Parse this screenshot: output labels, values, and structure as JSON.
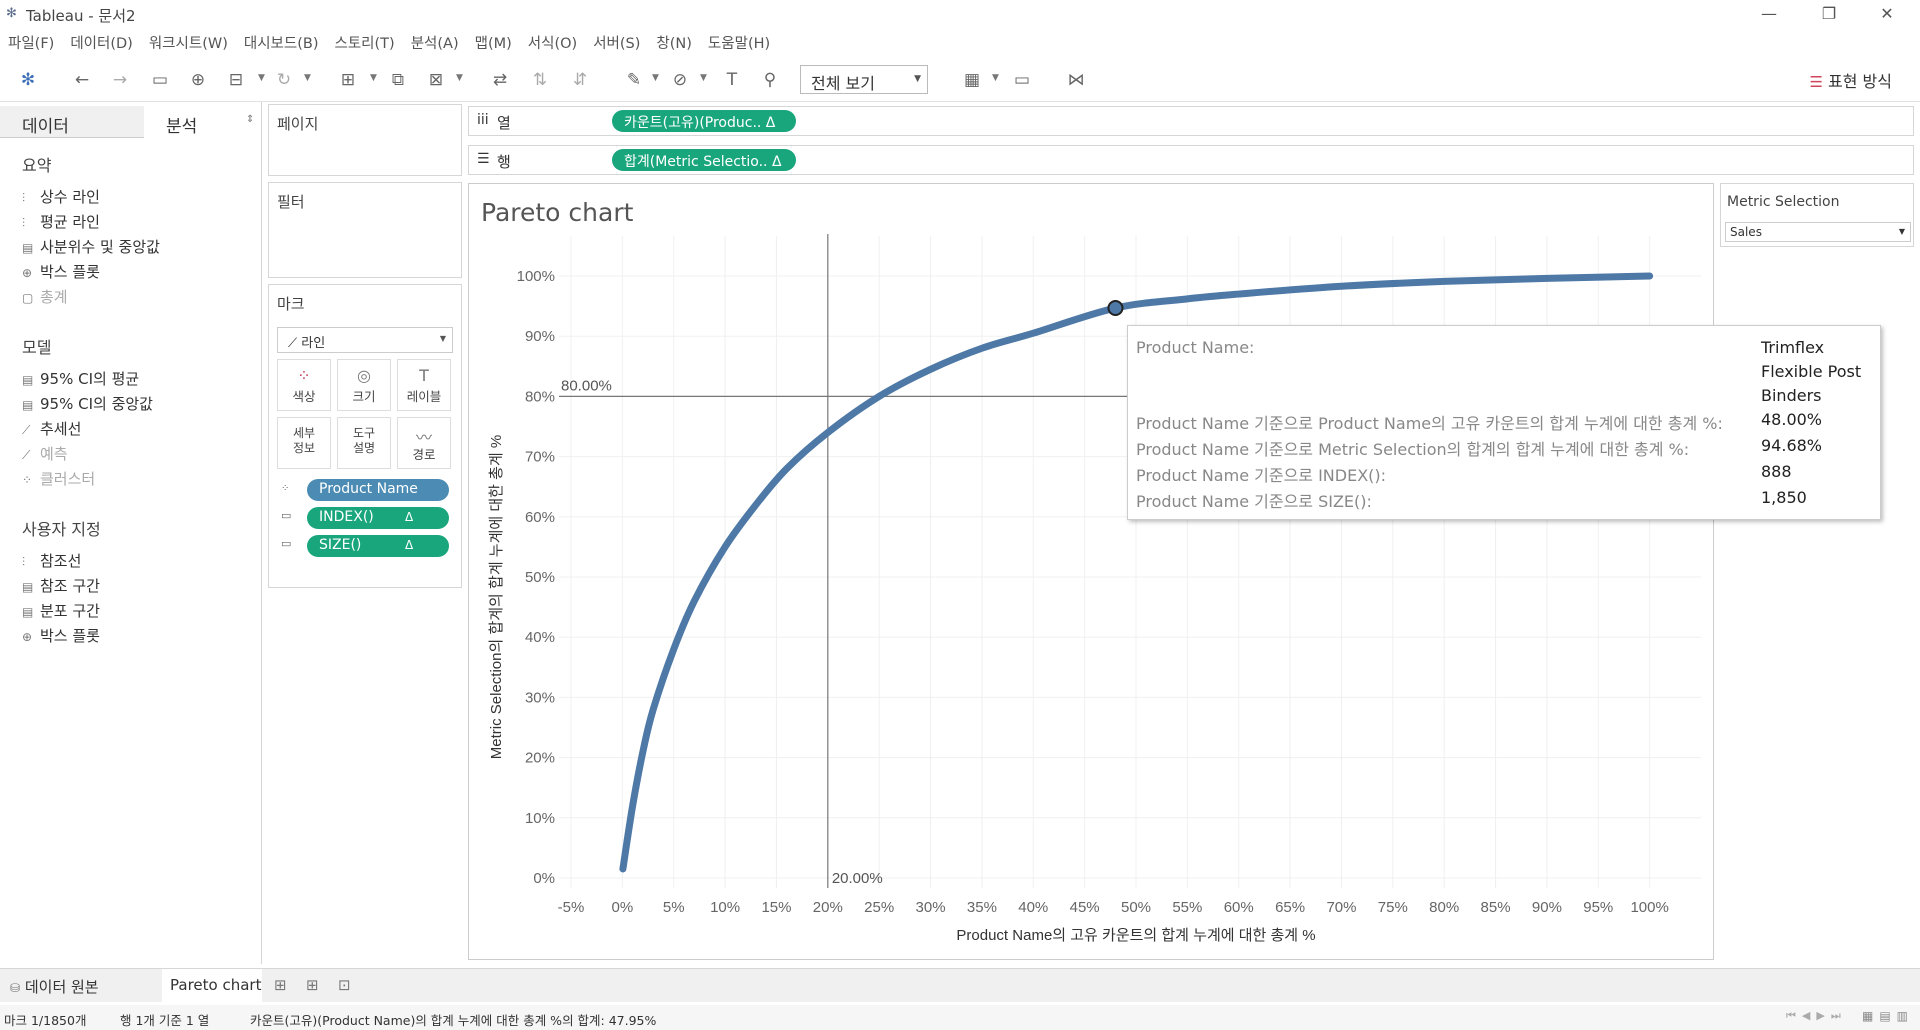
{
  "window": {
    "title": "Tableau - 문서2",
    "minimize": "—",
    "restore": "❐",
    "close": "✕"
  },
  "menu": [
    "파일(F)",
    "데이터(D)",
    "워크시트(W)",
    "대시보드(B)",
    "스토리(T)",
    "분석(A)",
    "맵(M)",
    "서식(O)",
    "서버(S)",
    "창(N)",
    "도움말(H)"
  ],
  "toolbar": {
    "view_mode": "전체 보기",
    "show_me": "표현 방식"
  },
  "left_panel": {
    "tab_data": "데이터",
    "tab_analysis": "분석",
    "summary_title": "요약",
    "summary_items": [
      "상수 라인",
      "평균 라인",
      "사분위수 및 중앙값",
      "박스 플롯",
      "총계"
    ],
    "model_title": "모델",
    "model_items": [
      "95% CI의 평균",
      "95% CI의 중앙값",
      "추세선",
      "예측",
      "클러스터"
    ],
    "custom_title": "사용자 지정",
    "custom_items": [
      "참조선",
      "참조 구간",
      "분포 구간",
      "박스 플롯"
    ]
  },
  "shelves": {
    "pages": "페이지",
    "filters": "필터",
    "marks": "마크",
    "mark_type": "라인",
    "mark_buttons": [
      "색상",
      "크기",
      "레이블",
      "세부\n정보",
      "도구\n설명",
      "경로"
    ],
    "mark_pills": [
      "Product Name",
      "INDEX()",
      "SIZE()"
    ],
    "columns_label": "열",
    "rows_label": "행",
    "columns_pill": "카운트(고유)(Produc.. Δ",
    "rows_pill": "합계(Metric Selectio.. Δ"
  },
  "parameter": {
    "title": "Metric Selection",
    "value": "Sales"
  },
  "chart_data": {
    "type": "line",
    "title": "Pareto chart",
    "xlabel": "Product Name의 고유 카운트의 합계 누계에 대한 총계 %",
    "ylabel": "Metric Selection의 합계의 합계 누계에 대한 총계 %",
    "x_ticks": [
      "-5%",
      "0%",
      "5%",
      "10%",
      "15%",
      "20%",
      "25%",
      "30%",
      "35%",
      "40%",
      "45%",
      "50%",
      "55%",
      "60%",
      "65%",
      "70%",
      "75%",
      "80%",
      "85%",
      "90%",
      "95%",
      "100%"
    ],
    "y_ticks": [
      "0%",
      "10%",
      "20%",
      "30%",
      "40%",
      "50%",
      "60%",
      "70%",
      "80%",
      "90%",
      "100%"
    ],
    "xlim": [
      -5,
      105
    ],
    "ylim": [
      0,
      100
    ],
    "series": [
      {
        "x": [
          0.05,
          1,
          2,
          3,
          5,
          7,
          10,
          13,
          16,
          20,
          25,
          30,
          35,
          40,
          48,
          55,
          60,
          70,
          80,
          90,
          100
        ],
        "y": [
          1.5,
          12,
          21,
          28,
          38,
          46,
          55,
          62,
          68,
          74,
          80,
          84.5,
          88,
          90.5,
          94.68,
          96.2,
          97,
          98.3,
          99.1,
          99.6,
          100
        ]
      }
    ],
    "ref_lines": [
      {
        "axis": "x",
        "value": 20,
        "label": "20.00%"
      },
      {
        "axis": "y",
        "value": 80,
        "label": "80.00%"
      }
    ],
    "highlight": {
      "x": 48.0,
      "y": 94.68
    },
    "line_color": "#4e79a7",
    "grid": true
  },
  "tooltip": {
    "rows": [
      {
        "key": "Product Name:",
        "value": "Trimflex"
      },
      {
        "key": "",
        "value": "Flexible Post"
      },
      {
        "key": "",
        "value": "Binders"
      },
      {
        "key": "Product Name 기준으로 Product Name의 고유 카운트의 합계 누계에 대한 총계 %:",
        "value": "48.00%"
      },
      {
        "key": "Product Name 기준으로 Metric Selection의 합계의 합계 누계에 대한 총계 %:",
        "value": "94.68%"
      },
      {
        "key": "Product Name 기준으로 INDEX():",
        "value": "888"
      },
      {
        "key": "Product Name 기준으로 SIZE():",
        "value": "1,850"
      }
    ]
  },
  "sheet_tabs": {
    "datasource": "데이터 원본",
    "active": "Pareto chart"
  },
  "status": {
    "marks": "마크 1/1850개",
    "rows_cols": "행 1개 기준 1 열",
    "sum": "카운트(고유)(Product Name)의 합계 누계에 대한 총계 %의 합계: 47.95%"
  }
}
